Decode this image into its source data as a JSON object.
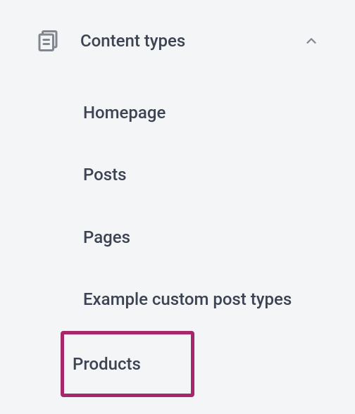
{
  "section": {
    "title": "Content types",
    "expanded": true,
    "icon_name": "document-icon",
    "items": [
      {
        "label": "Homepage",
        "highlighted": false
      },
      {
        "label": "Posts",
        "highlighted": false
      },
      {
        "label": "Pages",
        "highlighted": false
      },
      {
        "label": "Example custom post types",
        "highlighted": false
      },
      {
        "label": "Products",
        "highlighted": true
      }
    ]
  },
  "colors": {
    "text": "#3c4352",
    "icon": "#82868f",
    "highlight": "#a4286a",
    "background": "#f4f5f7"
  }
}
